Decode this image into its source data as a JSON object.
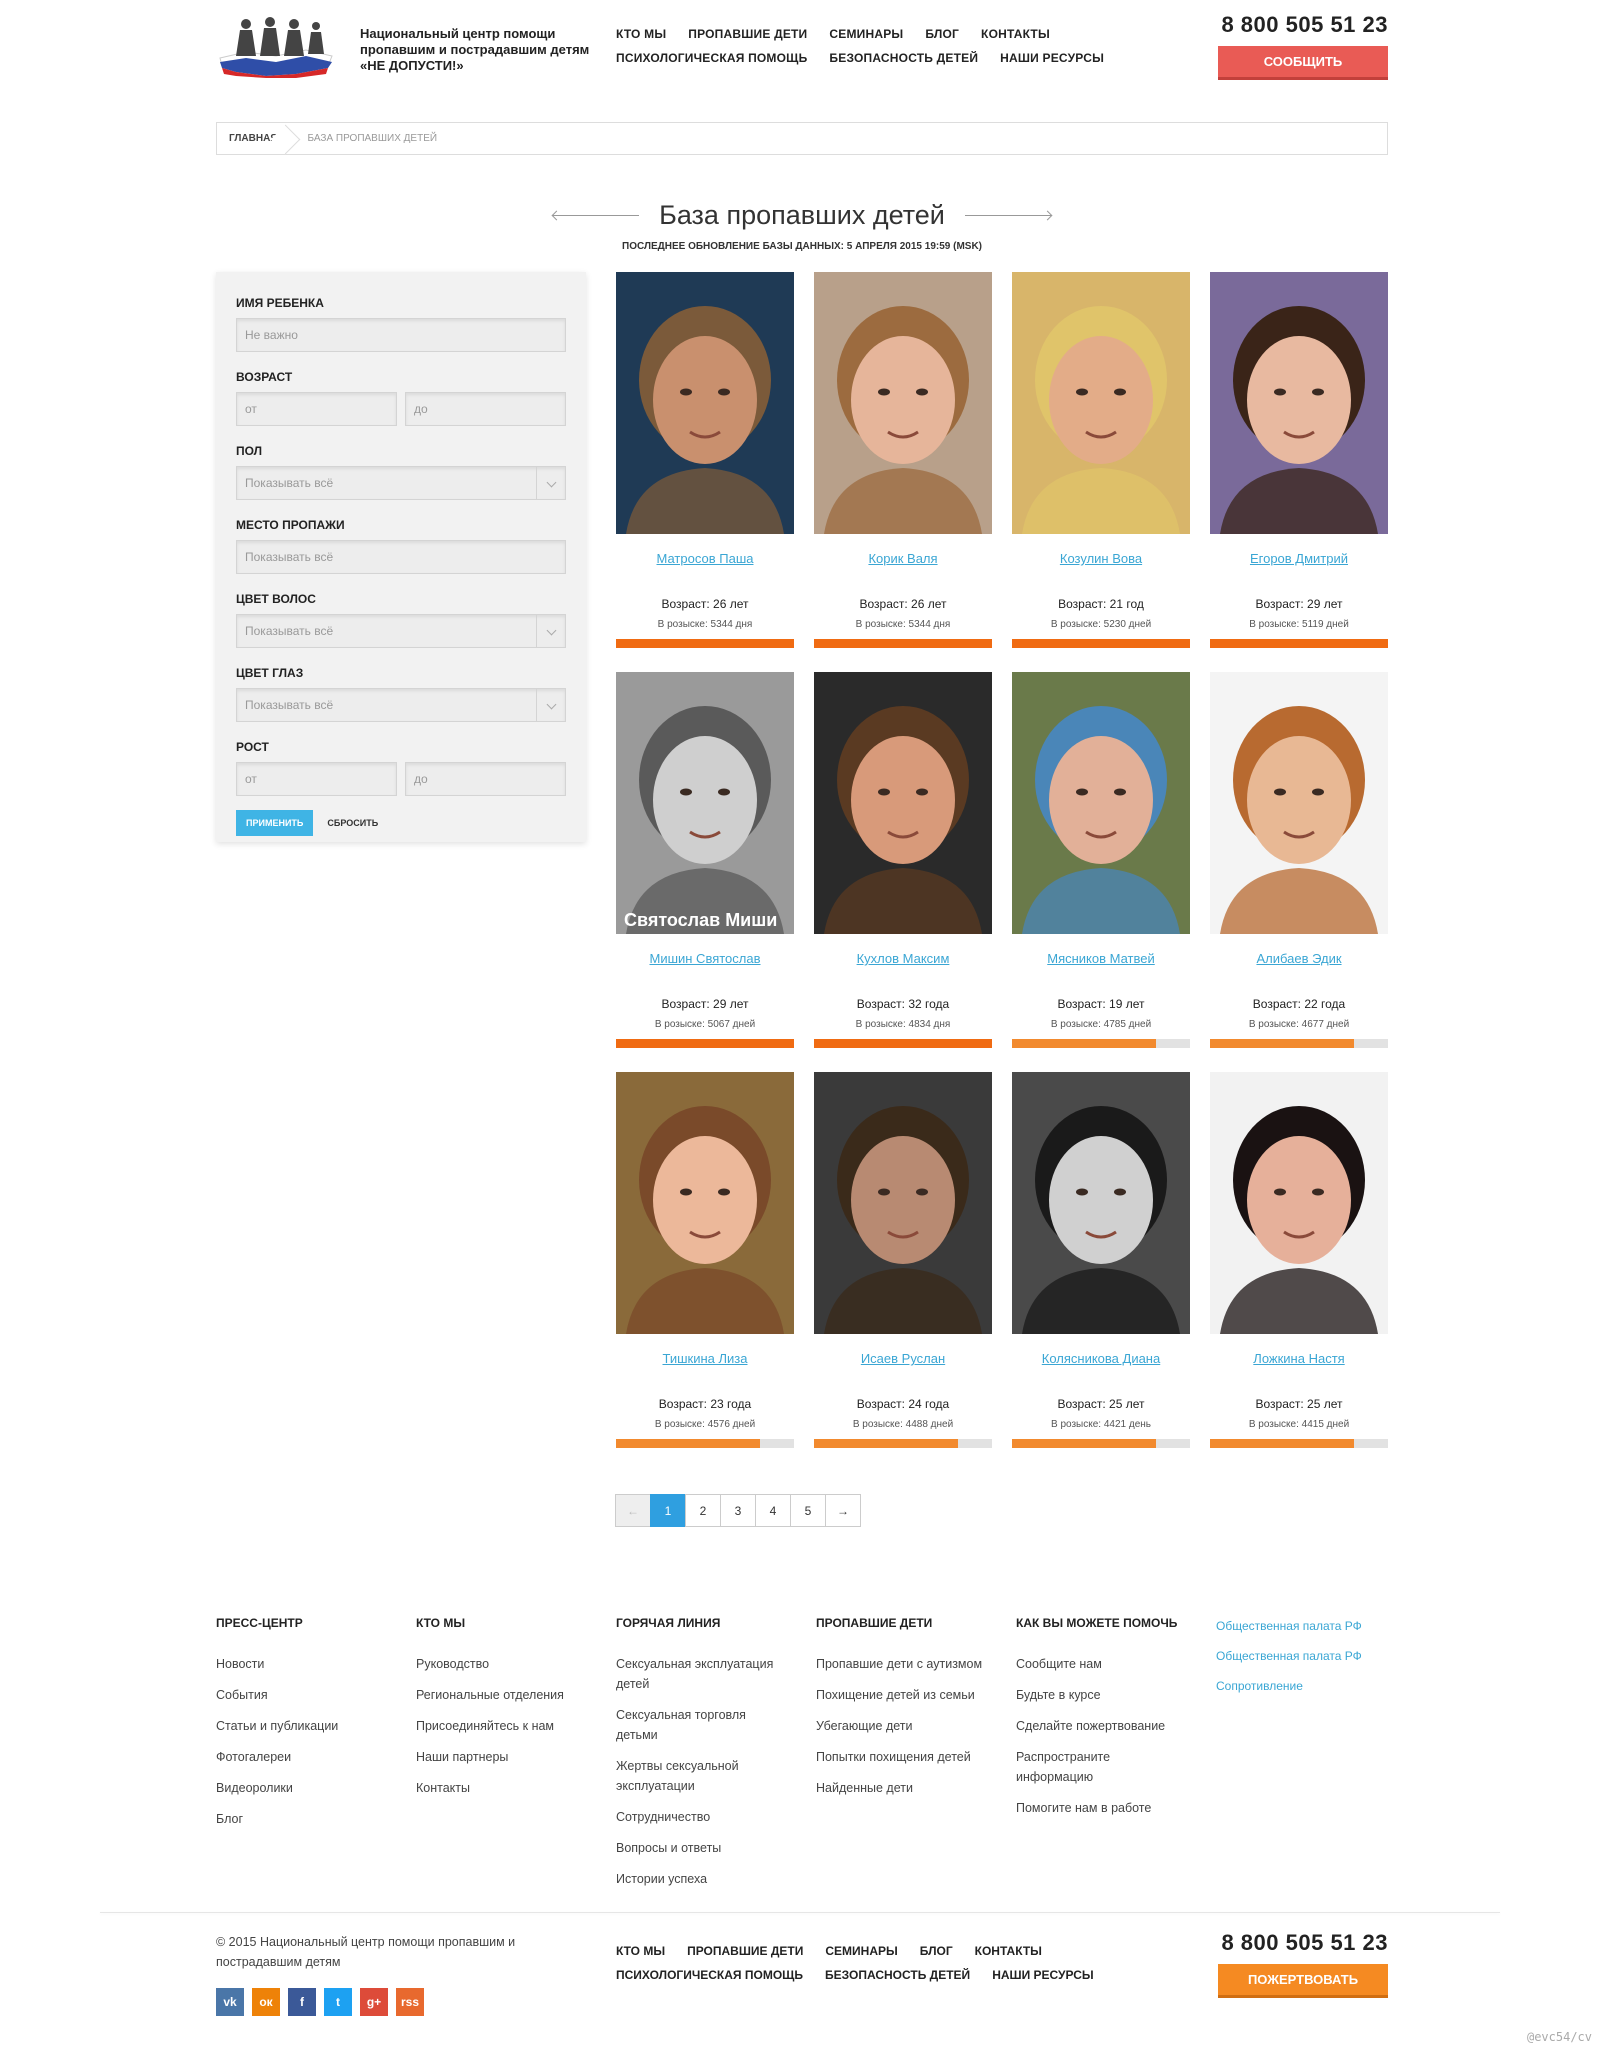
{
  "header": {
    "org_name_line1": "Национальный центр помощи",
    "org_name_line2": "пропавшим и пострадавшим детям",
    "org_name_line3": "«НЕ ДОПУСТИ!»",
    "nav_row1": [
      "КТО МЫ",
      "ПРОПАВШИЕ ДЕТИ",
      "СЕМИНАРЫ",
      "БЛОГ",
      "КОНТАКТЫ"
    ],
    "nav_row2": [
      "ПСИХОЛОГИЧЕСКАЯ ПОМОЩЬ",
      "БЕЗОПАСНОСТЬ ДЕТЕЙ",
      "НАШИ РЕСУРСЫ"
    ],
    "phone": "8 800 505 51 23",
    "report_button": "СООБЩИТЬ",
    "report_color": "#e95b55"
  },
  "breadcrumb": {
    "home": "ГЛАВНАЯ",
    "current": "БАЗА ПРОПАВШИХ ДЕТЕЙ"
  },
  "page": {
    "title": "База пропавших детей",
    "updated": "ПОСЛЕДНЕЕ ОБНОВЛЕНИЕ БАЗЫ ДАННЫХ: 5 АПРЕЛЯ 2015 19:59 (MSK)"
  },
  "filter": {
    "name_label": "ИМЯ РЕБЕНКА",
    "name_placeholder": "Не важно",
    "age_label": "ВОЗРАСТ",
    "from_placeholder": "от",
    "to_placeholder": "до",
    "gender_label": "ПОЛ",
    "show_all": "Показывать всё",
    "place_label": "МЕСТО ПРОПАЖИ",
    "hair_label": "ЦВЕТ ВОЛОС",
    "eyes_label": "ЦВЕТ ГЛАЗ",
    "height_label": "РОСТ",
    "apply": "ПРИМЕНИТЬ",
    "reset": "СБРОСИТЬ"
  },
  "children": [
    {
      "name": "Матросов Паша",
      "age": "Возраст: 26 лет",
      "days": "В розыске: 5344 дня",
      "progress": 1.0,
      "photo_bg": "#1f3a55",
      "photo_face": "#c9906e",
      "photo_hair": "#7b5a3a"
    },
    {
      "name": "Корик Валя",
      "age": "Возраст: 26 лет",
      "days": "В розыске: 5344 дня",
      "progress": 1.0,
      "photo_bg": "#b8a08a",
      "photo_face": "#e6b59a",
      "photo_hair": "#9c6b3f"
    },
    {
      "name": "Козулин Вова",
      "age": "Возраст: 21 год",
      "days": "В розыске: 5230 дней",
      "progress": 1.0,
      "photo_bg": "#d8b56a",
      "photo_face": "#e3ac88",
      "photo_hair": "#e0c46a"
    },
    {
      "name": "Егоров Дмитрий",
      "age": "Возраст: 29 лет",
      "days": "В розыске: 5119 дней",
      "progress": 1.0,
      "photo_bg": "#7a6a9a",
      "photo_face": "#e8b9a0",
      "photo_hair": "#3a2418"
    },
    {
      "name": "Мишин Святослав",
      "age": "Возраст: 29 лет",
      "days": "В розыске: 5067 дней",
      "progress": 1.0,
      "photo_bg": "#9a9a9a",
      "photo_face": "#cfcfcf",
      "photo_hair": "#5a5a5a"
    },
    {
      "name": "Кухлов Максим",
      "age": "Возраст: 32 года",
      "days": "В розыске: 4834 дня",
      "progress": 1.0,
      "photo_bg": "#2a2a2a",
      "photo_face": "#d89a7a",
      "photo_hair": "#5a3a22"
    },
    {
      "name": "Мясников Матвей",
      "age": "Возраст: 19 лет",
      "days": "В розыске: 4785 дней",
      "progress": 0.81,
      "photo_bg": "#6a7a4a",
      "photo_face": "#e2b098",
      "photo_hair": "#4a86b8"
    },
    {
      "name": "Алибаев Эдик",
      "age": "Возраст: 22 года",
      "days": "В розыске: 4677 дней",
      "progress": 0.81,
      "photo_bg": "#f4f4f4",
      "photo_face": "#e8b894",
      "photo_hair": "#b86a30"
    },
    {
      "name": "Тишкина Лиза",
      "age": "Возраст: 23 года",
      "days": "В розыске: 4576 дней",
      "progress": 0.81,
      "photo_bg": "#8a6a3a",
      "photo_face": "#ecb89a",
      "photo_hair": "#7a4a2a"
    },
    {
      "name": "Исаев Руслан",
      "age": "Возраст: 24 года",
      "days": "В розыске: 4488 дней",
      "progress": 0.81,
      "photo_bg": "#3a3a3a",
      "photo_face": "#b88a72",
      "photo_hair": "#3a2a1a"
    },
    {
      "name": "Колясникова Диана",
      "age": "Возраст: 25 лет",
      "days": "В розыске: 4421 день",
      "progress": 0.81,
      "photo_bg": "#4a4a4a",
      "photo_face": "#d0d0d0",
      "photo_hair": "#1a1a1a"
    },
    {
      "name": "Ложкина Настя",
      "age": "Возраст: 25 лет",
      "days": "В розыске: 4415 дней",
      "progress": 0.81,
      "photo_bg": "#f2f2f2",
      "photo_face": "#e6b09a",
      "photo_hair": "#1a1212"
    }
  ],
  "watermark_photo_text": "Святослав Миши",
  "pagination": [
    "←",
    "1",
    "2",
    "3",
    "4",
    "5",
    "→"
  ],
  "footer": {
    "cols": [
      {
        "title": "ПРЕСС-ЦЕНТР",
        "links": [
          "Новости",
          "События",
          "Статьи и публикации",
          "Фотогалереи",
          "Видеоролики",
          "Блог"
        ]
      },
      {
        "title": "КТО МЫ",
        "links": [
          "Руководство",
          "Региональные отделения",
          "Присоединяйтесь к нам",
          "Наши партнеры",
          "Контакты"
        ]
      },
      {
        "title": "ГОРЯЧАЯ ЛИНИЯ",
        "links": [
          "Сексуальная эксплуатация детей",
          "Сексуальная торговля детьми",
          "Жертвы сексуальной эксплуатации",
          "Сотрудничество",
          "Вопросы и ответы",
          "Истории успеха"
        ]
      },
      {
        "title": "ПРОПАВШИЕ ДЕТИ",
        "links": [
          "Пропавшие дети с аутизмом",
          "Похищение детей из семьи",
          "Убегающие дети",
          "Попытки похищения детей",
          "Найденные дети"
        ]
      },
      {
        "title": "КАК ВЫ МОЖЕТЕ ПОМОЧЬ",
        "links": [
          "Сообщите нам",
          "Будьте в курсе",
          "Сделайте пожертвование",
          "Распространите информацию",
          "Помогите нам в работе"
        ]
      }
    ],
    "badges": [
      "Общественная палата РФ",
      "Общественная палата РФ",
      "Сопротивление"
    ],
    "copyright": "© 2015 Национальный центр помощи пропавшим и пострадавшим детям",
    "social": [
      {
        "icon": "vk-icon",
        "glyph": "vk",
        "color": "#4a76a8"
      },
      {
        "icon": "odnoklassniki-icon",
        "glyph": "ок",
        "color": "#ee8208"
      },
      {
        "icon": "facebook-icon",
        "glyph": "f",
        "color": "#3b5998"
      },
      {
        "icon": "twitter-icon",
        "glyph": "t",
        "color": "#1da1f2"
      },
      {
        "icon": "google-plus-icon",
        "glyph": "g+",
        "color": "#dd4b39"
      },
      {
        "icon": "rss-icon",
        "glyph": "rss",
        "color": "#e8692e"
      }
    ],
    "phone": "8 800 505 51 23",
    "donate_button": "ПОЖЕРТВОВАТЬ",
    "donate_color": "#f58a22"
  },
  "watermark": "@evc54/cv"
}
